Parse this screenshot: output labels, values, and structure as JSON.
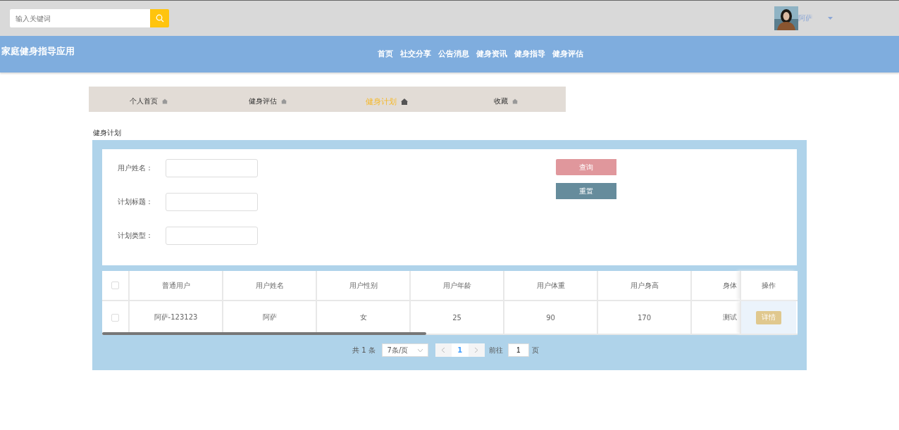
{
  "header": {
    "search": {
      "placeholder": "输入关键词"
    },
    "user": {
      "name": "阿萨"
    }
  },
  "navbar": {
    "title": "家庭健身指导应用",
    "items": [
      {
        "label": "首页"
      },
      {
        "label": "社交分享"
      },
      {
        "label": "公告消息"
      },
      {
        "label": "健身资讯"
      },
      {
        "label": "健身指导"
      },
      {
        "label": "健身评估"
      }
    ]
  },
  "tabs": [
    {
      "label": "个人首页",
      "selected": false
    },
    {
      "label": "健身评估",
      "selected": false
    },
    {
      "label": "健身计划",
      "selected": true
    },
    {
      "label": "收藏",
      "selected": false
    }
  ],
  "section_title": "健身计划",
  "filters": [
    {
      "label": "用户姓名："
    },
    {
      "label": "计划标题："
    },
    {
      "label": "计划类型："
    }
  ],
  "buttons": [
    {
      "label": "查询",
      "kind": "search"
    },
    {
      "label": "重置",
      "kind": "reset"
    }
  ],
  "table": {
    "all_checked": false,
    "columns": [
      "普通用户",
      "用户姓名",
      "用户性别",
      "用户年龄",
      "用户体重",
      "用户身高",
      "身体"
    ],
    "action_column": "操作",
    "rows": [
      {
        "checked": false,
        "cells": [
          "阿萨-123123",
          "阿萨",
          "女",
          "25",
          "90",
          "170",
          "测试"
        ],
        "action": "详情"
      }
    ]
  },
  "pagination": {
    "total": "共 1 条",
    "page_size": "7条/页",
    "page": "1",
    "goto_label": "前往",
    "goto_value": "1",
    "page_suffix": "页"
  }
}
